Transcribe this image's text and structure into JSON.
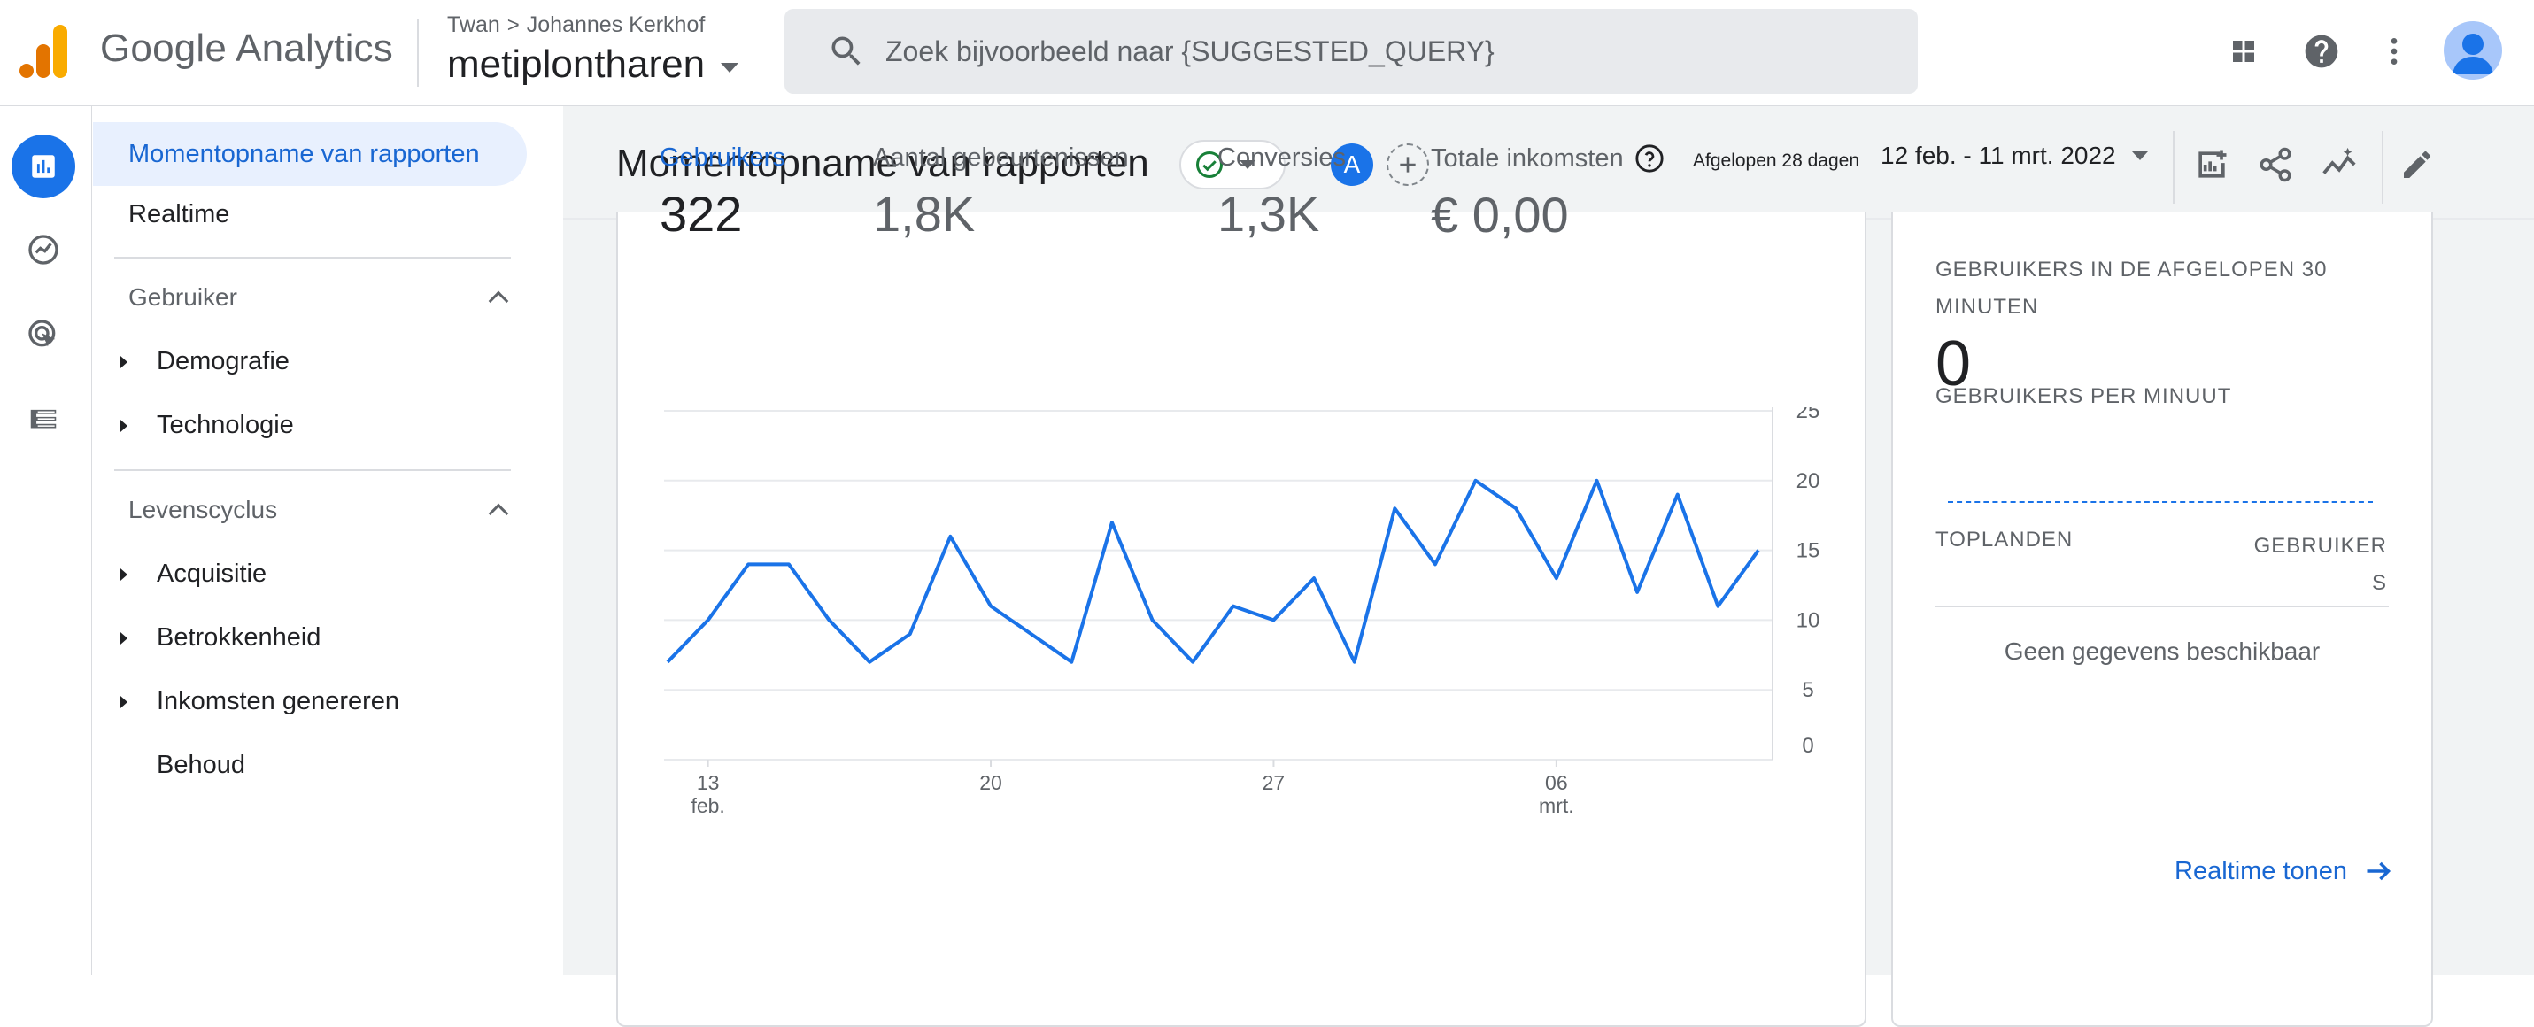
{
  "app": {
    "product_name": "Google Analytics",
    "breadcrumb_account": "Twan",
    "breadcrumb_sep": ">",
    "breadcrumb_property": "Johannes Kerkhof",
    "property_name": "metiplontharen",
    "search_placeholder": "Zoek bijvoorbeeld naar {SUGGESTED_QUERY}",
    "avatar_color": "#a8c7fa"
  },
  "rail": {
    "items": [
      {
        "icon": "reports-icon",
        "active": true
      },
      {
        "icon": "explore-icon",
        "active": false
      },
      {
        "icon": "advertising-icon",
        "active": false
      },
      {
        "icon": "configure-icon",
        "active": false
      }
    ]
  },
  "nav": {
    "snapshot": "Momentopname van rapporten",
    "realtime": "Realtime",
    "section_user": "Gebruiker",
    "user_items": [
      "Demografie",
      "Technologie"
    ],
    "section_lifecycle": "Levenscyclus",
    "lifecycle_items": [
      "Acquisitie",
      "Betrokkenheid",
      "Inkomsten genereren",
      "Behoud"
    ]
  },
  "header": {
    "title": "Momentopname van rapporten",
    "compare_label": "A",
    "date_preset": "Afgelopen 28 dagen",
    "date_range": "12 feb. - 11 mrt. 2022"
  },
  "metrics": [
    {
      "label": "Gebruikers",
      "value": "322",
      "active": true
    },
    {
      "label": "Aantal gebeurtenissen",
      "value": "1,8K",
      "active": false
    },
    {
      "label": "Conversies",
      "value": "1,3K",
      "active": false
    },
    {
      "label": "Totale inkomsten",
      "value": "€ 0,00",
      "active": false,
      "help": true
    }
  ],
  "chart_data": {
    "type": "line",
    "series": [
      {
        "name": "Gebruikers",
        "values": [
          7,
          10,
          14,
          14,
          10,
          7,
          9,
          16,
          11,
          9,
          7,
          17,
          10,
          7,
          11,
          10,
          13,
          7,
          18,
          14,
          20,
          18,
          13,
          20,
          12,
          19,
          11,
          15
        ],
        "color": "#1a73e8"
      }
    ],
    "x_tick_labels": [
      {
        "line1": "13",
        "line2": "feb.",
        "index": 1
      },
      {
        "line1": "20",
        "line2": "",
        "index": 8
      },
      {
        "line1": "27",
        "line2": "",
        "index": 15
      },
      {
        "line1": "06",
        "line2": "mrt.",
        "index": 22
      }
    ],
    "y_ticks": [
      "0",
      "5",
      "10",
      "15",
      "20",
      "25"
    ],
    "ylim": [
      0,
      25
    ],
    "grid": true,
    "y_axis_position": "right",
    "title": "",
    "xlabel": "",
    "ylabel": ""
  },
  "realtime": {
    "title": "GEBRUIKERS IN DE AFGELOPEN 30 MINUTEN",
    "value": "0",
    "per_minute": "GEBRUIKERS PER MINUUT",
    "col_left": "TOPLANDEN",
    "col_right": "GEBRUIKERS",
    "empty": "Geen gegevens beschikbaar",
    "link": "Realtime tonen"
  }
}
